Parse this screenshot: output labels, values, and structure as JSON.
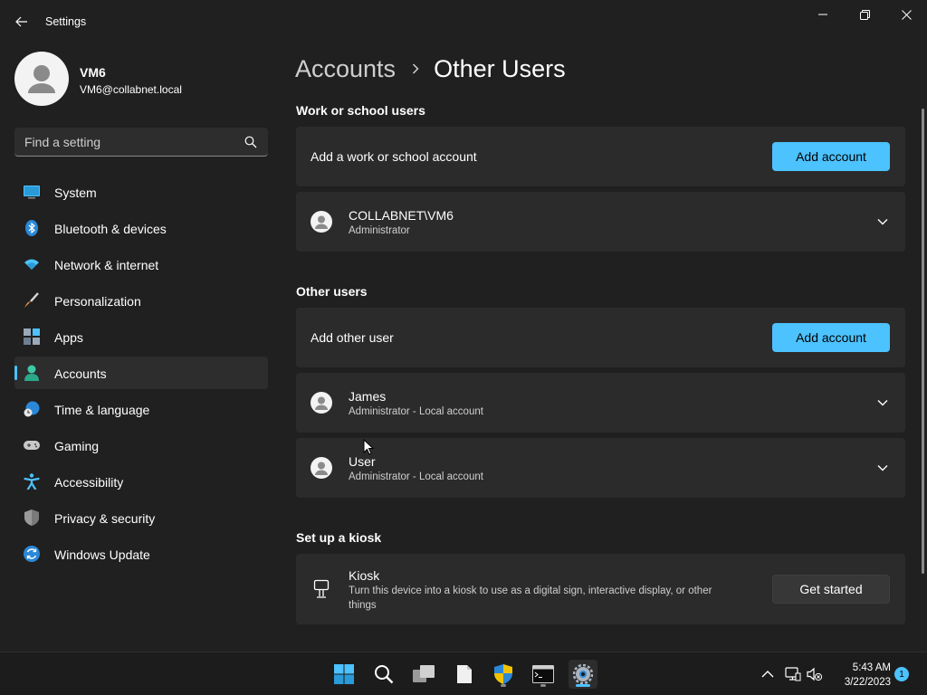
{
  "window": {
    "title": "Settings"
  },
  "profile": {
    "name": "VM6",
    "email": "VM6@collabnet.local"
  },
  "search": {
    "placeholder": "Find a setting"
  },
  "sidebar": {
    "items": [
      {
        "label": "System",
        "icon": "system-icon"
      },
      {
        "label": "Bluetooth & devices",
        "icon": "bluetooth-icon"
      },
      {
        "label": "Network & internet",
        "icon": "wifi-icon"
      },
      {
        "label": "Personalization",
        "icon": "brush-icon"
      },
      {
        "label": "Apps",
        "icon": "apps-icon"
      },
      {
        "label": "Accounts",
        "icon": "accounts-icon",
        "active": true
      },
      {
        "label": "Time & language",
        "icon": "globe-clock-icon"
      },
      {
        "label": "Gaming",
        "icon": "gamepad-icon"
      },
      {
        "label": "Accessibility",
        "icon": "accessibility-icon"
      },
      {
        "label": "Privacy & security",
        "icon": "shield-icon"
      },
      {
        "label": "Windows Update",
        "icon": "update-icon"
      }
    ]
  },
  "breadcrumb": {
    "parent": "Accounts",
    "current": "Other Users"
  },
  "work_school": {
    "heading": "Work or school users",
    "add_text": "Add a work or school account",
    "add_button": "Add account",
    "users": [
      {
        "name": "COLLABNET\\VM6",
        "role": "Administrator"
      }
    ]
  },
  "other_users": {
    "heading": "Other users",
    "add_text": "Add other user",
    "add_button": "Add account",
    "users": [
      {
        "name": "James",
        "role": "Administrator - Local account"
      },
      {
        "name": "User",
        "role": "Administrator - Local account"
      }
    ]
  },
  "kiosk": {
    "heading": "Set up a kiosk",
    "title": "Kiosk",
    "description_line1": "Turn this device into a kiosk to use as a digital sign, interactive display, or other",
    "description_line2": "things",
    "button": "Get started"
  },
  "taskbar": {
    "time": "5:43 AM",
    "date": "3/22/2023",
    "notification_count": "1",
    "accent": "#4cc2ff"
  }
}
